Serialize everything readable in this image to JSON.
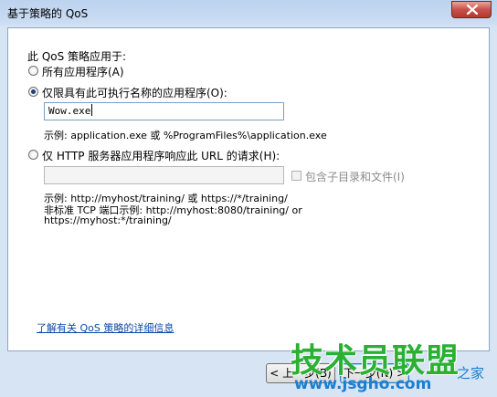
{
  "window": {
    "title": "基于策略的 QoS"
  },
  "main": {
    "applies_label": "此 QoS 策略应用于:",
    "option_all": "所有应用程序(A)",
    "option_named": "仅限具有此可执行名称的应用程序(O):",
    "exe_value": "Wow.exe",
    "exe_example": "示例:  application.exe 或 %ProgramFiles%\\application.exe",
    "option_http": "仅 HTTP 服务器应用程序响应此 URL 的请求(H):",
    "url_value": "",
    "include_subdirs": "包含子目录和文件(I)",
    "url_example_1": "示例:  http://myhost/training/ 或 https://*/training/",
    "url_example_2": "非标准 TCP 端口示例:  http://myhost:8080/training/ or",
    "url_example_3": "https://myhost:*/training/",
    "learn_more": "了解有关 QoS 策略的详细信息"
  },
  "footer": {
    "back_label": "< 上一步(B)",
    "next_label": "下一步(N) >"
  },
  "watermark": {
    "line1": "技术员联盟",
    "line2": "www.jsgho.com",
    "line3": "之家"
  },
  "colors": {
    "link": "#0a48a8",
    "watermark_green": "#2bb034",
    "watermark_blue": "#1a7fd0"
  }
}
